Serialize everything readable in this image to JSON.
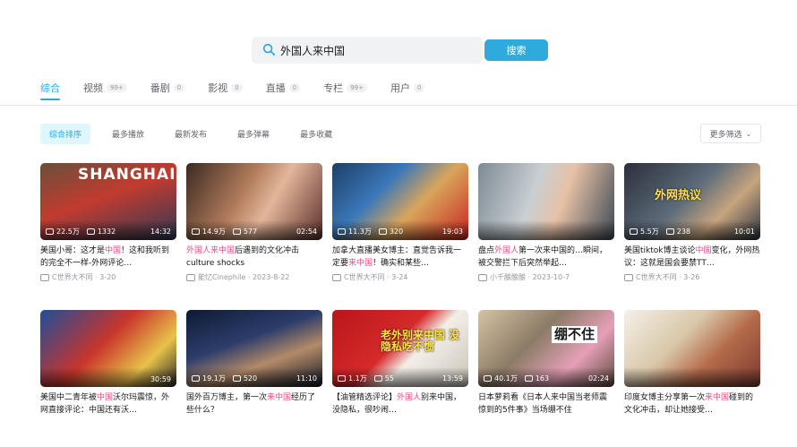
{
  "search": {
    "value": "外国人来中国",
    "button": "搜索"
  },
  "tabs": [
    {
      "label": "综合",
      "badge": ""
    },
    {
      "label": "视频",
      "badge": "99+"
    },
    {
      "label": "番剧",
      "badge": "0"
    },
    {
      "label": "影视",
      "badge": "0"
    },
    {
      "label": "直播",
      "badge": "0"
    },
    {
      "label": "专栏",
      "badge": "99+"
    },
    {
      "label": "用户",
      "badge": "0"
    }
  ],
  "filters": [
    "综合排序",
    "最多播放",
    "最新发布",
    "最多弹幕",
    "最多收藏"
  ],
  "more_filter": "更多筛选",
  "videos": [
    {
      "thumb_text": "SHANGHAI",
      "play": "22.5万",
      "danmaku": "1332",
      "duration": "14:32",
      "title_pre": "美国小哥：这才是",
      "title_hl": "中国",
      "title_post": "！这和我听到的完全不一样-外网评论…",
      "uploader": "C世界大不同",
      "date": "3-20"
    },
    {
      "thumb_text": "",
      "play": "14.9万",
      "danmaku": "577",
      "duration": "02:54",
      "title_pre": "",
      "title_hl": "外国人来中国",
      "title_post": "后遇到的文化冲击 culture shocks",
      "uploader": "能忆Cinephile",
      "date": "2023-8-22"
    },
    {
      "thumb_text": "",
      "play": "11.3万",
      "danmaku": "320",
      "duration": "19:03",
      "title_pre": "加拿大直播美女博主：直觉告诉我一定要",
      "title_hl": "来中国",
      "title_post": "！确实和某些…",
      "uploader": "C世界大不同",
      "date": "3-24"
    },
    {
      "thumb_text": "",
      "play": "",
      "danmaku": "",
      "duration": "",
      "title_pre": "盘点",
      "title_hl": "外国人",
      "title_post": "第一次来中国的…瞬间，被交警拦下后突然举起…",
      "uploader": "小千酿酿酿",
      "date": "2023-10-7"
    },
    {
      "thumb_text": "外网热议",
      "play": "5.5万",
      "danmaku": "238",
      "duration": "10:01",
      "title_pre": "美国tiktok博主谈论",
      "title_hl": "中国",
      "title_post": "变化，外网热议：这就是国会要禁TT…",
      "uploader": "C世界大不同",
      "date": "3-26"
    },
    {
      "thumb_text": "",
      "play": "",
      "danmaku": "",
      "duration": "30:59",
      "title_pre": "美国中二青年被",
      "title_hl": "中国",
      "title_post": "沃尔玛震惊，外网直接评论：中国还有沃…",
      "uploader": "",
      "date": ""
    },
    {
      "thumb_text": "",
      "play": "19.1万",
      "danmaku": "520",
      "duration": "11:10",
      "title_pre": "国外百万博主，第一次",
      "title_hl": "来中国",
      "title_post": "经历了些什么？",
      "uploader": "",
      "date": ""
    },
    {
      "thumb_text": "老外别来中国 没隐私吃不惯",
      "play": "1.1万",
      "danmaku": "55",
      "duration": "13:59",
      "title_pre": "【油管精选评论】",
      "title_hl": "外国人",
      "title_post": "别来中国，没隐私，很吵闹…",
      "uploader": "",
      "date": ""
    },
    {
      "thumb_text": "绷不住",
      "play": "40.1万",
      "danmaku": "163",
      "duration": "02:24",
      "title_pre": "日本萝莉看《日本人来中国当老师震惊到的5件事》当场绷不住",
      "title_hl": "",
      "title_post": "",
      "uploader": "",
      "date": ""
    },
    {
      "thumb_text": "",
      "play": "",
      "danmaku": "",
      "duration": "",
      "title_pre": "印度女博主分享第一次",
      "title_hl": "来中国",
      "title_post": "碰到的文化冲击，却让她接受…",
      "uploader": "",
      "date": ""
    }
  ],
  "colors": {
    "accent": "#2eaadc",
    "highlight": "#e84d86"
  }
}
